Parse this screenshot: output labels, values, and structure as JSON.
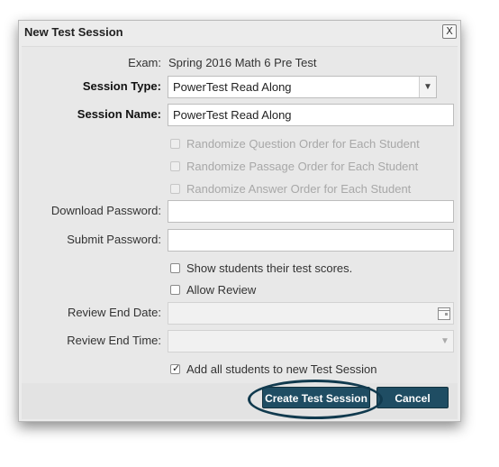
{
  "dialog": {
    "title": "New Test Session",
    "close_glyph": "X"
  },
  "form": {
    "exam": {
      "label": "Exam:",
      "value": "Spring 2016 Math 6 Pre Test"
    },
    "session_type": {
      "label": "Session Type:",
      "value": "PowerTest Read Along"
    },
    "session_name": {
      "label": "Session Name:",
      "value": "PowerTest Read Along"
    },
    "randomize": [
      {
        "label": "Randomize Question Order for Each Student",
        "checked": false,
        "enabled": false
      },
      {
        "label": "Randomize Passage Order for Each Student",
        "checked": false,
        "enabled": false
      },
      {
        "label": "Randomize Answer Order for Each Student",
        "checked": false,
        "enabled": false
      }
    ],
    "download_password": {
      "label": "Download Password:",
      "value": ""
    },
    "submit_password": {
      "label": "Submit Password:",
      "value": ""
    },
    "show_scores": {
      "label": "Show students their test scores.",
      "checked": false
    },
    "allow_review": {
      "label": "Allow Review",
      "checked": false
    },
    "review_end_date": {
      "label": "Review End Date:",
      "value": ""
    },
    "review_end_time": {
      "label": "Review End Time:",
      "value": ""
    },
    "add_all_students": {
      "label": "Add all students to new Test Session",
      "checked": true
    }
  },
  "footer": {
    "create_label": "Create Test Session",
    "cancel_label": "Cancel",
    "button_color": "#1f4d63",
    "highlight_color": "#113a4e"
  },
  "icons": {
    "select_arrow": "chevron-down-icon",
    "calendar": "calendar-icon",
    "close": "close-icon",
    "check": "check-icon"
  }
}
